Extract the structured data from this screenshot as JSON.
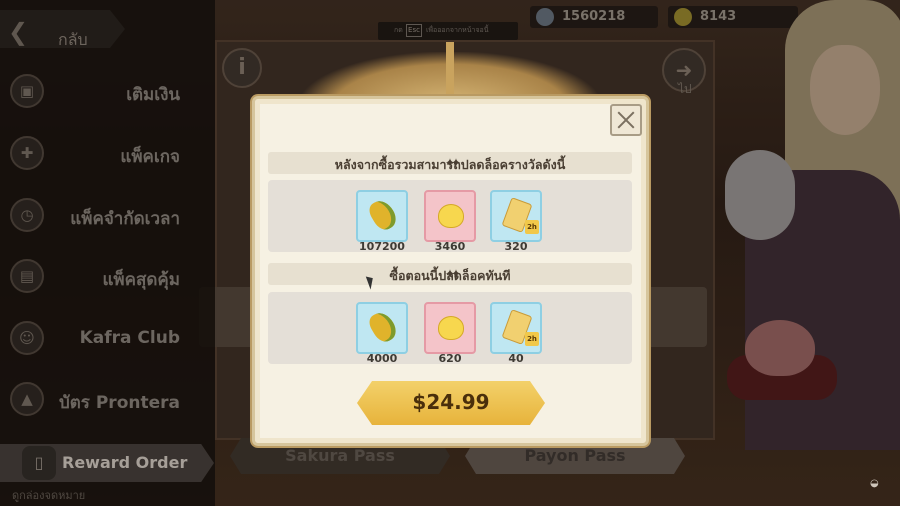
{
  "window": {
    "back_label": "กลับ",
    "esc_hint_prefix": "กด",
    "esc_key": "Esc",
    "esc_hint_text": "เพื่อออกจากหน้าจอนี้"
  },
  "currencies": [
    {
      "icon": "diamond-icon",
      "value": "1560218"
    },
    {
      "icon": "poring-coin-icon",
      "value": "8143"
    }
  ],
  "sidebar": {
    "items": [
      {
        "label": "เติมเงิน",
        "icon": "gift-box-icon"
      },
      {
        "label": "แพ็คเกจ",
        "icon": "gift-icon"
      },
      {
        "label": "แพ็คจำกัดเวลา",
        "icon": "clock-icon"
      },
      {
        "label": "แพ็คสุดคุ้ม",
        "icon": "bag-icon"
      },
      {
        "label": "Kafra Club",
        "icon": "user-icon"
      },
      {
        "label": "บัตร Prontera",
        "icon": "bell-icon"
      }
    ],
    "reward_order": "Reward Order",
    "bottom_text": "ดูกล่องจดหมาย"
  },
  "passes": {
    "tabs": [
      {
        "label": "Sakura Pass"
      },
      {
        "label": "Payon Pass"
      }
    ],
    "next_label": "ไป"
  },
  "modal": {
    "section1_title": "หลังจากซื้อรวมสามารถปลดล็อครางวัลดังนี้",
    "section1_items": [
      {
        "icon": "zeny-icon",
        "qty": "107200",
        "bg": "blue"
      },
      {
        "icon": "poring-icon",
        "qty": "3460",
        "bg": "pink"
      },
      {
        "icon": "ticket-icon",
        "qty": "320",
        "bg": "blue",
        "badge": "2h"
      }
    ],
    "section2_title": "ซื้อตอนนี้ปลดล็อคทันที",
    "section2_items": [
      {
        "icon": "zeny-icon",
        "qty": "4000",
        "bg": "blue"
      },
      {
        "icon": "poring-icon",
        "qty": "620",
        "bg": "pink"
      },
      {
        "icon": "ticket-icon",
        "qty": "40",
        "bg": "blue",
        "badge": "2h"
      }
    ],
    "price": "$24.99"
  },
  "colors": {
    "accent_gold": "#e7b33b",
    "modal_bg": "#f6f1e3"
  }
}
